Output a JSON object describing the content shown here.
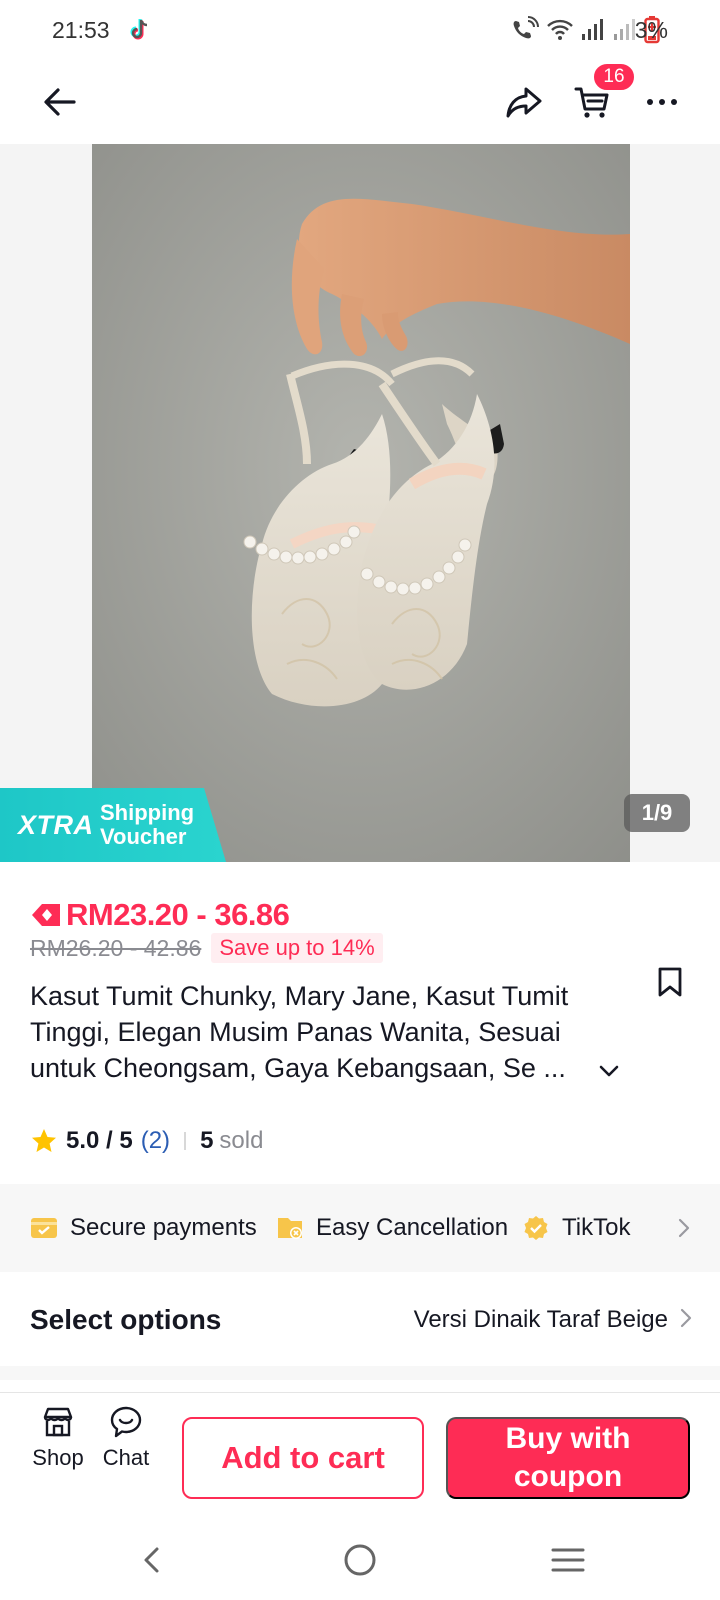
{
  "status_bar": {
    "time": "21:53",
    "battery": "3%",
    "app_icon": "tiktok-icon"
  },
  "header": {
    "cart_count": "16",
    "icons": [
      "back-arrow-icon",
      "share-icon",
      "cart-icon",
      "more-icon"
    ]
  },
  "gallery": {
    "page_indicator": "1/9",
    "xtra_badge": {
      "brand": "XTRA",
      "line1": "Shipping",
      "line2": "Voucher"
    }
  },
  "price": {
    "range": "RM23.20 - 36.86",
    "original_range": "RM26.20 - 42.86",
    "save_label": "Save up to 14%"
  },
  "product": {
    "title_lines": [
      "Kasut Tumit Chunky, Mary Jane, Kasut Tumit",
      "Tinggi, Elegan Musim Panas Wanita, Sesuai",
      "untuk Cheongsam, Gaya Kebangsaan, Se ..."
    ]
  },
  "rating": {
    "score": "5.0 / 5",
    "count": "(2)",
    "sold_number": "5",
    "sold_label": "sold"
  },
  "features": [
    {
      "label": "Secure payments",
      "icon": "secure-payment-icon"
    },
    {
      "label": "Easy Cancellation",
      "icon": "easy-cancellation-icon"
    },
    {
      "label": "TikTok",
      "icon": "tiktok-guarantee-icon"
    }
  ],
  "options": {
    "label": "Select options",
    "value": "Versi Dinaik Taraf Beige"
  },
  "bottom_bar": {
    "shop_label": "Shop",
    "chat_label": "Chat",
    "add_to_cart": "Add to cart",
    "buy_line1": "Buy with",
    "buy_line2": "coupon"
  },
  "colors": {
    "accent": "#fe2c55",
    "xtra": "#1ec7c7",
    "rating_link": "#2b5db3",
    "feature_icon": "#f7c54a"
  }
}
